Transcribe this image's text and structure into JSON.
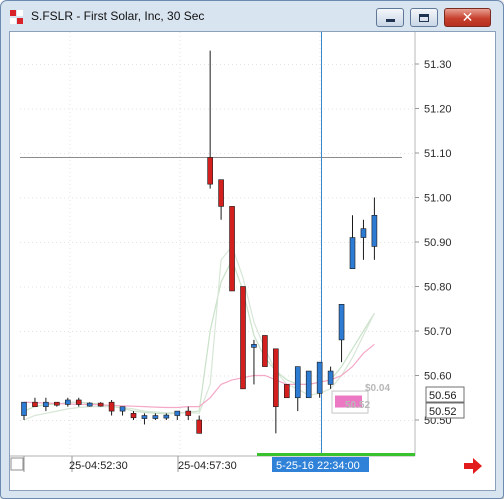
{
  "window": {
    "title": "S.FSLR - First Solar, Inc, 30 Sec",
    "buttons": {
      "minimize": "minimize",
      "maximize": "maximize",
      "close": "close"
    }
  },
  "chart_data": {
    "type": "candlestick",
    "ylim": [
      50.45,
      51.38
    ],
    "grid": true,
    "y_ticks": [
      "51.30",
      "51.20",
      "51.10",
      "51.00",
      "50.90",
      "50.80",
      "50.70",
      "50.60",
      "50.50"
    ],
    "y_tick_values": [
      51.3,
      51.2,
      51.1,
      51.0,
      50.9,
      50.8,
      50.7,
      50.6,
      50.5
    ],
    "x_tick_labels": [
      "25-04:52:30",
      "25-04:57:30"
    ],
    "crosshair": {
      "time_label": "5-25-16 22:34:00",
      "price": 51.09
    },
    "price_labels": [
      {
        "text": "50.56",
        "value": 50.56
      },
      {
        "text": "50.52",
        "value": 50.52
      }
    ],
    "annotations": [
      "$0.04",
      "50.52"
    ],
    "candles": [
      {
        "o": 50.51,
        "h": 50.54,
        "l": 50.5,
        "c": 50.54
      },
      {
        "o": 50.54,
        "h": 50.55,
        "l": 50.53,
        "c": 50.53
      },
      {
        "o": 50.53,
        "h": 50.55,
        "l": 50.52,
        "c": 50.54
      },
      {
        "o": 50.54,
        "h": 50.54,
        "l": 50.53,
        "c": 50.535
      },
      {
        "o": 50.535,
        "h": 50.55,
        "l": 50.53,
        "c": 50.545
      },
      {
        "o": 50.545,
        "h": 50.55,
        "l": 50.53,
        "c": 50.535
      },
      {
        "o": 50.535,
        "h": 50.54,
        "l": 50.53,
        "c": 50.538
      },
      {
        "o": 50.538,
        "h": 50.54,
        "l": 50.53,
        "c": 50.532
      },
      {
        "o": 50.54,
        "h": 50.545,
        "l": 50.51,
        "c": 50.52
      },
      {
        "o": 50.52,
        "h": 50.53,
        "l": 50.51,
        "c": 50.53
      },
      {
        "o": 50.515,
        "h": 50.52,
        "l": 50.5,
        "c": 50.505
      },
      {
        "o": 50.505,
        "h": 50.515,
        "l": 50.49,
        "c": 50.51
      },
      {
        "o": 50.508,
        "h": 50.515,
        "l": 50.5,
        "c": 50.51
      },
      {
        "o": 50.508,
        "h": 50.515,
        "l": 50.5,
        "c": 50.511
      },
      {
        "o": 50.51,
        "h": 50.52,
        "l": 50.5,
        "c": 50.52
      },
      {
        "o": 50.52,
        "h": 50.53,
        "l": 50.5,
        "c": 50.51
      },
      {
        "o": 50.5,
        "h": 50.51,
        "l": 50.47,
        "c": 50.47
      },
      {
        "o": 51.09,
        "h": 51.33,
        "l": 51.02,
        "c": 51.03
      },
      {
        "o": 51.04,
        "h": 51.01,
        "l": 50.95,
        "c": 50.98
      },
      {
        "o": 50.98,
        "h": 50.98,
        "l": 50.79,
        "c": 50.79
      },
      {
        "o": 50.8,
        "h": 50.8,
        "l": 50.57,
        "c": 50.57
      },
      {
        "o": 50.67,
        "h": 50.68,
        "l": 50.58,
        "c": 50.67
      },
      {
        "o": 50.69,
        "h": 50.69,
        "l": 50.62,
        "c": 50.62
      },
      {
        "o": 50.66,
        "h": 50.66,
        "l": 50.47,
        "c": 50.53
      },
      {
        "o": 50.58,
        "h": 50.58,
        "l": 50.55,
        "c": 50.55
      },
      {
        "o": 50.55,
        "h": 50.62,
        "l": 50.52,
        "c": 50.62
      },
      {
        "o": 50.55,
        "h": 50.61,
        "l": 50.55,
        "c": 50.61
      },
      {
        "o": 50.56,
        "h": 50.63,
        "l": 50.55,
        "c": 50.63
      },
      {
        "o": 50.58,
        "h": 50.62,
        "l": 50.57,
        "c": 50.61
      },
      {
        "o": 50.68,
        "h": 50.76,
        "l": 50.63,
        "c": 50.76
      },
      {
        "o": 50.84,
        "h": 50.96,
        "l": 50.85,
        "c": 50.91
      },
      {
        "o": 50.91,
        "h": 50.95,
        "l": 50.86,
        "c": 50.93
      },
      {
        "o": 50.89,
        "h": 51.0,
        "l": 50.86,
        "c": 50.96
      }
    ],
    "series": [
      {
        "type": "line",
        "color": "#c8e2c8",
        "values": [
          50.52,
          50.53,
          50.535,
          50.535,
          50.54,
          50.54,
          50.538,
          50.535,
          50.53,
          50.527,
          50.52,
          50.517,
          50.515,
          50.514,
          50.515,
          50.517,
          50.52,
          50.7,
          50.81,
          50.86,
          50.79,
          50.69,
          50.64,
          50.61,
          50.59,
          50.58,
          50.58,
          50.585,
          50.59,
          50.62,
          50.66,
          50.7,
          50.74
        ]
      },
      {
        "type": "line",
        "color": "#d7e6d7",
        "values": [
          50.5,
          50.51,
          50.515,
          50.52,
          50.525,
          50.528,
          50.53,
          50.53,
          50.53,
          50.528,
          50.525,
          50.52,
          50.518,
          50.516,
          50.516,
          50.517,
          50.515,
          50.58,
          50.86,
          50.89,
          50.82,
          50.72,
          50.66,
          50.61,
          50.58,
          50.57,
          50.555,
          50.56,
          50.57,
          50.6,
          50.64,
          50.69,
          50.74
        ]
      },
      {
        "type": "line",
        "color": "#f4a8c6",
        "values": [
          50.54,
          50.539,
          50.538,
          50.537,
          50.536,
          50.535,
          50.535,
          50.534,
          50.533,
          50.532,
          50.531,
          50.53,
          50.529,
          50.528,
          50.528,
          50.53,
          50.53,
          50.55,
          50.58,
          50.59,
          50.595,
          50.6,
          50.6,
          50.59,
          50.58,
          50.58,
          50.58,
          50.585,
          50.59,
          50.6,
          50.62,
          50.65,
          50.67
        ]
      }
    ],
    "colors": {
      "up": "#2e7bd3",
      "down": "#d41f1f",
      "crosshair_v": "#3a86cf",
      "crosshair_h": "#8c8c8c",
      "selection": "#ec78c4"
    }
  }
}
